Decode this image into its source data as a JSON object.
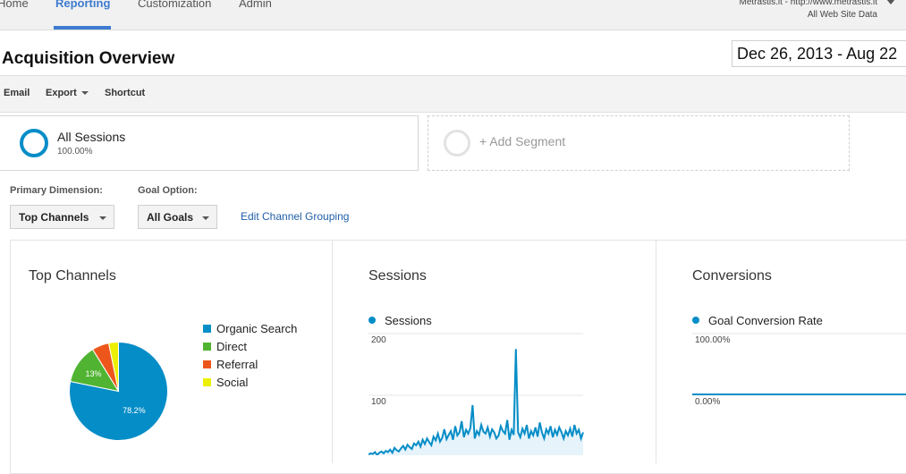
{
  "nav": {
    "items": [
      "Home",
      "Reporting",
      "Customization",
      "Admin"
    ],
    "active": "Reporting"
  },
  "account": {
    "site": "Metrastis.lt - http://www.metrastis.lt",
    "view": "All Web Site Data"
  },
  "page": {
    "title": "Acquisition Overview",
    "date_range": "Dec 26, 2013 - Aug 22"
  },
  "toolbar": {
    "email": "Email",
    "export": "Export",
    "shortcut": "Shortcut"
  },
  "segments": {
    "active_name": "All Sessions",
    "active_pct": "100.00%",
    "add_label": "+ Add Segment"
  },
  "filters": {
    "primary_label": "Primary Dimension:",
    "primary_value": "Top Channels",
    "goal_label": "Goal Option:",
    "goal_value": "All Goals",
    "edit_link": "Edit Channel Grouping"
  },
  "panels": {
    "channels_title": "Top Channels",
    "sessions_title": "Sessions",
    "conversions_title": "Conversions"
  },
  "colors": {
    "accent": "#3d7bd0",
    "series": "#058dc7",
    "organic": "#058dc7",
    "direct": "#50b432",
    "referral": "#ed561b",
    "social": "#edef00"
  },
  "chart_data": [
    {
      "type": "pie",
      "labels": [
        "Organic Search",
        "Direct",
        "Referral",
        "Social"
      ],
      "values": [
        78.2,
        13,
        5.6,
        3.2
      ],
      "data_labels": [
        "78.2%",
        "13%"
      ],
      "legend": "right"
    },
    {
      "type": "area",
      "series": [
        {
          "name": "Sessions",
          "values": [
            4,
            6,
            5,
            8,
            3,
            7,
            9,
            6,
            10,
            8,
            12,
            7,
            15,
            11,
            9,
            14,
            18,
            12,
            20,
            16,
            13,
            22,
            19,
            25,
            17,
            28,
            21,
            30,
            24,
            19,
            33,
            27,
            38,
            25,
            31,
            45,
            29,
            36,
            42,
            28,
            50,
            35,
            40,
            58,
            32,
            44,
            38,
            47,
            84,
            30,
            42,
            36,
            52,
            41,
            38,
            48,
            33,
            45,
            40,
            30,
            35,
            50,
            42,
            38,
            60,
            28,
            44,
            36,
            175,
            40,
            32,
            46,
            38,
            52,
            30,
            42,
            35,
            48,
            33,
            56,
            40,
            30,
            45,
            38,
            50,
            32,
            44,
            36,
            48,
            40,
            30,
            42,
            35,
            46,
            33,
            52,
            38,
            44,
            30,
            40
          ]
        }
      ],
      "ylim": [
        0,
        200
      ],
      "yticks": [
        "200",
        "100"
      ],
      "grid": true,
      "legend": "top-left"
    },
    {
      "type": "line",
      "series": [
        {
          "name": "Goal Conversion Rate",
          "values": [
            0,
            0,
            0,
            0,
            0,
            0,
            0,
            0,
            0,
            0
          ]
        }
      ],
      "yticks": [
        "100.00%",
        "0.00%"
      ],
      "grid": true,
      "legend": "top-left"
    }
  ]
}
